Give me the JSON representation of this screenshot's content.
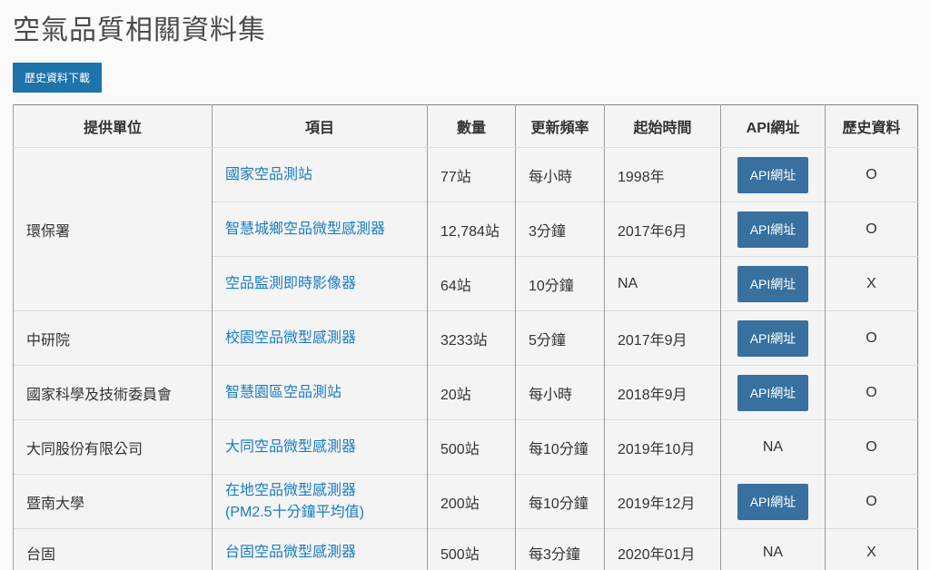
{
  "page": {
    "title": "空氣品質相關資料集",
    "download_button": "歷史資料下載"
  },
  "colors": {
    "link_blue": "#1a7cc1",
    "download_button_blue": "#1e73aa",
    "api_button_blue": "#38709f",
    "cell_background": "#f4f4f4"
  },
  "table": {
    "headers": [
      "提供單位",
      "項目",
      "數量",
      "更新頻率",
      "起始時間",
      "API網址",
      "歷史資料"
    ],
    "rows": [
      {
        "provider": "環保署",
        "provider_rowspan": 3,
        "item": "國家空品測站",
        "count": "77站",
        "frequency": "每小時",
        "start": "1998年",
        "api": "API網址",
        "api_type": "button",
        "history": "O"
      },
      {
        "item": "智慧城鄉空品微型感測器",
        "count": "12,784站",
        "frequency": "3分鐘",
        "start": "2017年6月",
        "api": "API網址",
        "api_type": "button",
        "history": "O"
      },
      {
        "item": "空品監測即時影像器",
        "count": "64站",
        "frequency": "10分鐘",
        "start": "NA",
        "api": "API網址",
        "api_type": "button",
        "history": "X"
      },
      {
        "provider": "中研院",
        "provider_rowspan": 1,
        "item": "校園空品微型感測器",
        "count": "3233站",
        "frequency": "5分鐘",
        "start": "2017年9月",
        "api": "API網址",
        "api_type": "button",
        "history": "O"
      },
      {
        "provider": "國家科學及技術委員會",
        "provider_rowspan": 1,
        "item": "智慧園區空品測站",
        "count": "20站",
        "frequency": "每小時",
        "start": "2018年9月",
        "api": "API網址",
        "api_type": "button",
        "history": "O"
      },
      {
        "provider": "大同股份有限公司",
        "provider_rowspan": 1,
        "item": "大同空品微型感測器",
        "count": "500站",
        "frequency": "每10分鐘",
        "start": "2019年10月",
        "api": "NA",
        "api_type": "text",
        "history": "O"
      },
      {
        "provider": "暨南大學",
        "provider_rowspan": 1,
        "item": "在地空品微型感測器\n(PM2.5十分鐘平均值)",
        "count": "200站",
        "frequency": "每10分鐘",
        "start": "2019年12月",
        "api": "API網址",
        "api_type": "button",
        "history": "O"
      },
      {
        "provider": "台固",
        "provider_rowspan": 1,
        "item": "台固空品微型感測器",
        "count": "500站",
        "frequency": "每3分鐘",
        "start": "2020年01月",
        "api": "NA",
        "api_type": "text",
        "history": "X"
      }
    ]
  }
}
